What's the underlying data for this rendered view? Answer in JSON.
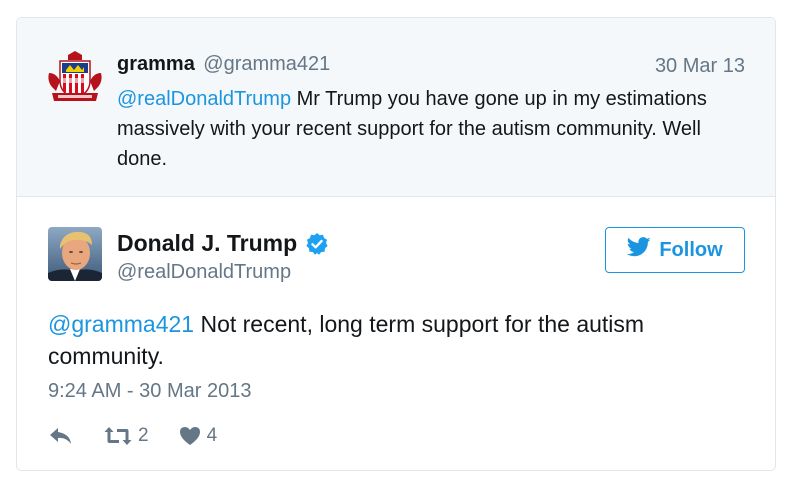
{
  "parent_tweet": {
    "name": "gramma",
    "handle": "@gramma421",
    "date": "30 Mar 13",
    "mention": "@realDonaldTrump",
    "text": " Mr Trump you have gone up in my estimations massively with your recent support for the autism community. Well done.",
    "avatar_icon": "sunderland-crest-icon"
  },
  "main_tweet": {
    "name": "Donald J. Trump",
    "handle": "@realDonaldTrump",
    "verified_icon": "verified-badge-icon",
    "mention": "@gramma421",
    "text": " Not recent, long term support for the autism community.",
    "timestamp": "9:24 AM - 30 Mar 2013",
    "follow_label": "Follow",
    "follow_icon": "twitter-bird-icon",
    "actions": {
      "reply_icon": "reply-icon",
      "retweet_icon": "retweet-icon",
      "retweet_count": "2",
      "like_icon": "heart-icon",
      "like_count": "4"
    }
  },
  "colors": {
    "link": "#1b95e0",
    "secondary_text": "#657786",
    "parent_background": "#f5f8fa",
    "border": "#e1e8ed"
  }
}
